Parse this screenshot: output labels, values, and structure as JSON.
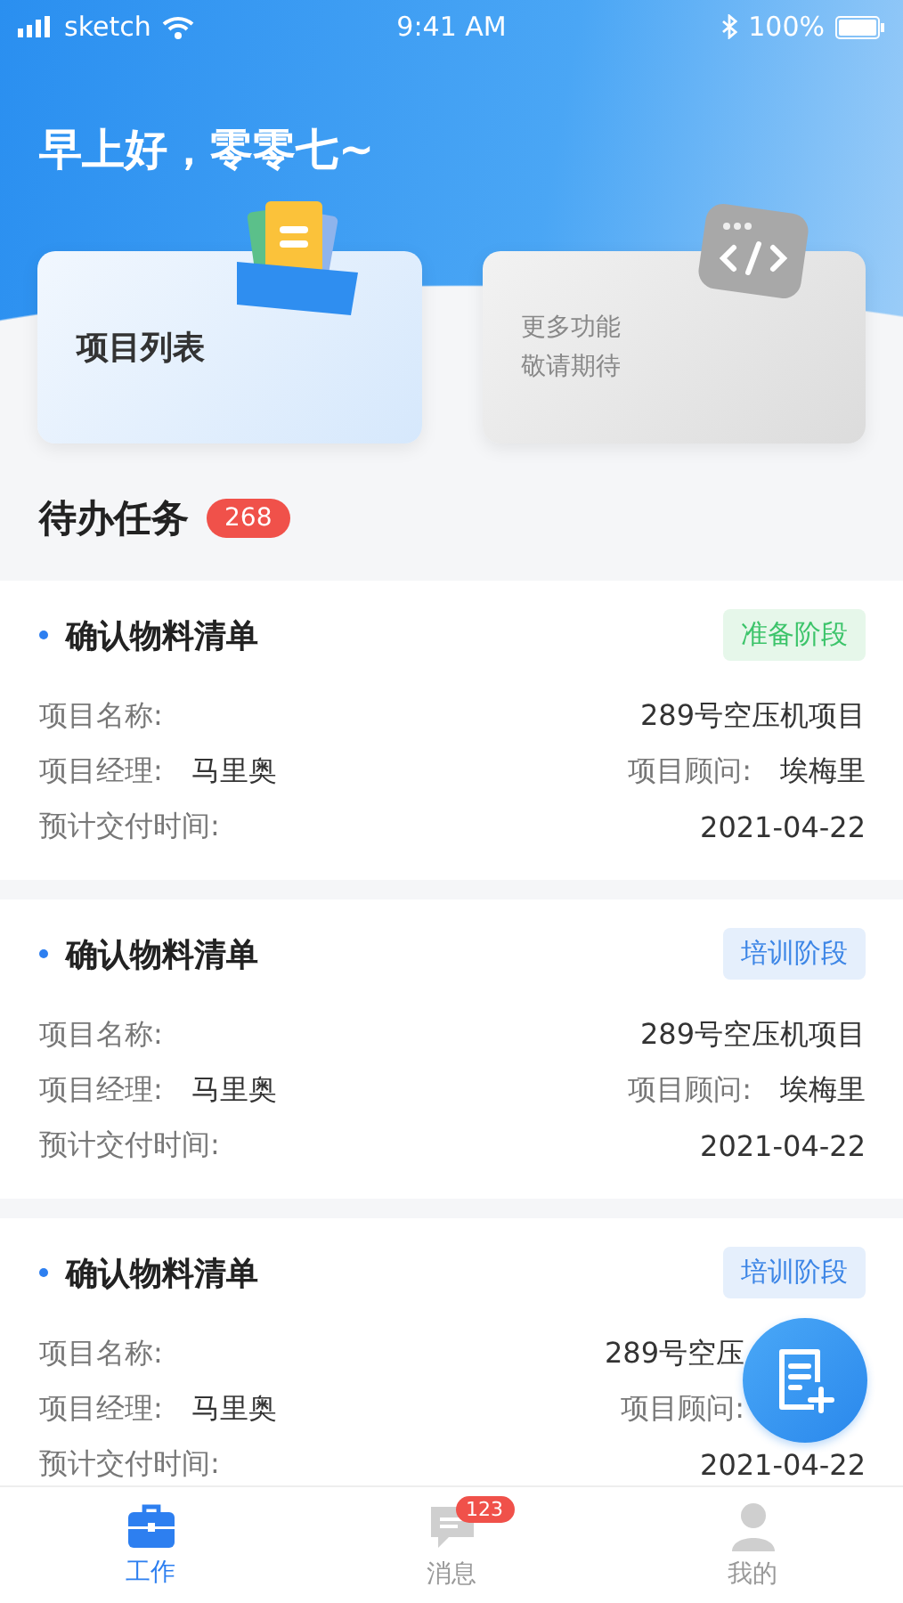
{
  "status_bar": {
    "carrier": "sketch",
    "time": "9:41 AM",
    "battery": "100%"
  },
  "greeting": "早上好，零零七~",
  "shortcuts": [
    {
      "kind": "projects",
      "lines": [
        "项目列表"
      ],
      "disabled": false
    },
    {
      "kind": "more",
      "lines": [
        "更多功能",
        "敬请期待"
      ],
      "disabled": true
    }
  ],
  "todo": {
    "title": "待办任务",
    "count": "268"
  },
  "tasks": [
    {
      "title": "确认物料清单",
      "stage": {
        "label": "准备阶段",
        "kind": "prep"
      },
      "rows": [
        [
          {
            "label": "项目名称:",
            "value": "289号空压机项目"
          }
        ],
        [
          {
            "label": "项目经理:",
            "value": "马里奥"
          },
          {
            "label": "项目顾问:",
            "value": "埃梅里"
          }
        ],
        [
          {
            "label": "预计交付时间:",
            "value": "2021-04-22"
          }
        ]
      ]
    },
    {
      "title": "确认物料清单",
      "stage": {
        "label": "培训阶段",
        "kind": "training"
      },
      "rows": [
        [
          {
            "label": "项目名称:",
            "value": "289号空压机项目"
          }
        ],
        [
          {
            "label": "项目经理:",
            "value": "马里奥"
          },
          {
            "label": "项目顾问:",
            "value": "埃梅里"
          }
        ],
        [
          {
            "label": "预计交付时间:",
            "value": "2021-04-22"
          }
        ]
      ]
    },
    {
      "title": "确认物料清单",
      "stage": {
        "label": "培训阶段",
        "kind": "training"
      },
      "rows": [
        [
          {
            "label": "项目名称:",
            "value": "289号空压",
            "covered": true
          }
        ],
        [
          {
            "label": "项目经理:",
            "value": "马里奥"
          },
          {
            "label": "项目顾问:",
            "covered": true
          }
        ],
        [
          {
            "label": "预计交付时间:",
            "value": "2021-04-22"
          }
        ]
      ]
    }
  ],
  "tab_bar": [
    {
      "kind": "work",
      "label": "工作",
      "selected": true
    },
    {
      "kind": "messages",
      "label": "消息",
      "selected": false,
      "badge": "123"
    },
    {
      "kind": "me",
      "label": "我的",
      "selected": false
    }
  ]
}
